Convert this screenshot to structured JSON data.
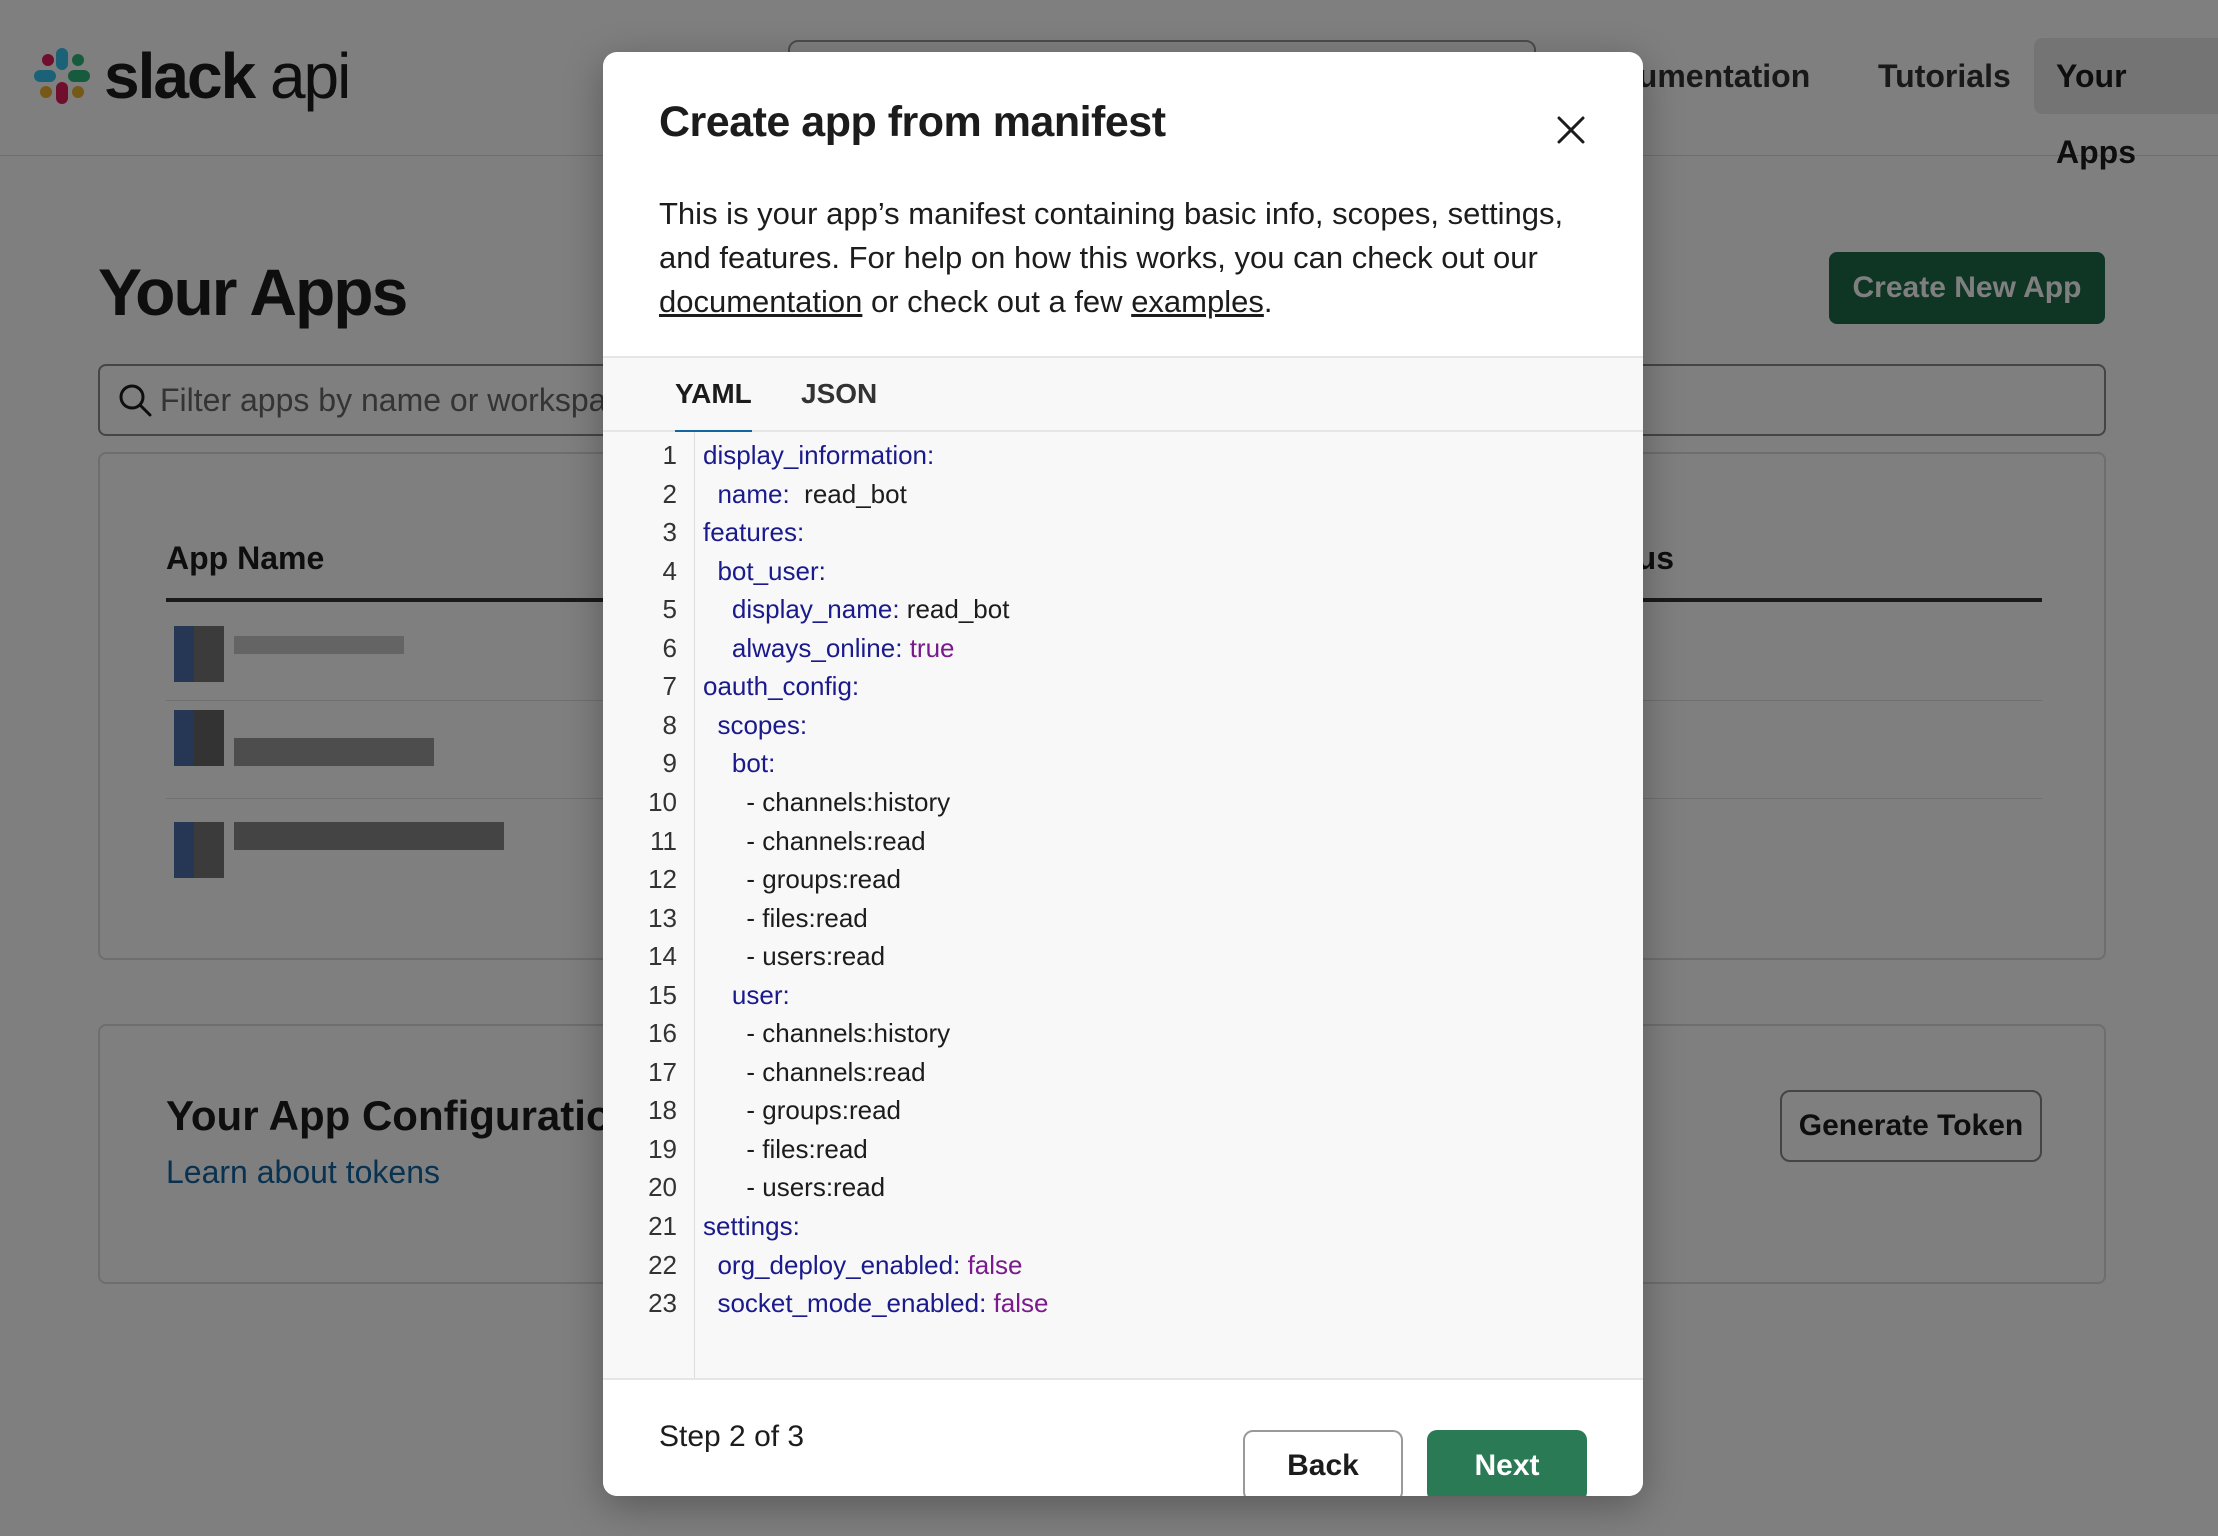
{
  "header": {
    "logo_bold": "slack",
    "logo_light": "api",
    "nav": [
      "cumentation",
      "Tutorials",
      "Your Apps"
    ]
  },
  "main": {
    "title": "Your Apps",
    "create_button": "Create New App",
    "filter_placeholder": "Filter apps by name or workspace",
    "table": {
      "col_name": "App Name",
      "col_status": "tus"
    },
    "token_card": {
      "title": "Your App Configuration T",
      "link": "Learn about tokens",
      "button": "Generate Token"
    }
  },
  "modal": {
    "title": "Create app from manifest",
    "description_prefix": "This is your app’s manifest containing basic info, scopes, settings, and features. For help on how this works, you can check out our ",
    "link_documentation": "documentation",
    "description_middle": " or check out a few ",
    "link_examples": "examples",
    "description_suffix": ".",
    "tabs": [
      "YAML",
      "JSON"
    ],
    "active_tab": "YAML",
    "code_lines": [
      {
        "n": "1",
        "indent": "",
        "key": "display_information",
        "sep": ":",
        "val": "",
        "vtype": "none"
      },
      {
        "n": "2",
        "indent": "  ",
        "key": "name",
        "sep": ":  ",
        "val": "read_bot",
        "vtype": "plain"
      },
      {
        "n": "3",
        "indent": "",
        "key": "features",
        "sep": ":",
        "val": "",
        "vtype": "none"
      },
      {
        "n": "4",
        "indent": "  ",
        "key": "bot_user",
        "sep": ":",
        "val": "",
        "vtype": "none"
      },
      {
        "n": "5",
        "indent": "    ",
        "key": "display_name",
        "sep": ": ",
        "val": "read_bot",
        "vtype": "plain"
      },
      {
        "n": "6",
        "indent": "    ",
        "key": "always_online",
        "sep": ": ",
        "val": "true",
        "vtype": "bool"
      },
      {
        "n": "7",
        "indent": "",
        "key": "oauth_config",
        "sep": ":",
        "val": "",
        "vtype": "none"
      },
      {
        "n": "8",
        "indent": "  ",
        "key": "scopes",
        "sep": ":",
        "val": "",
        "vtype": "none"
      },
      {
        "n": "9",
        "indent": "    ",
        "key": "bot",
        "sep": ":",
        "val": "",
        "vtype": "none"
      },
      {
        "n": "10",
        "indent": "      ",
        "key": "",
        "sep": "- ",
        "val": "channels:history",
        "vtype": "plain"
      },
      {
        "n": "11",
        "indent": "      ",
        "key": "",
        "sep": "- ",
        "val": "channels:read",
        "vtype": "plain"
      },
      {
        "n": "12",
        "indent": "      ",
        "key": "",
        "sep": "- ",
        "val": "groups:read",
        "vtype": "plain"
      },
      {
        "n": "13",
        "indent": "      ",
        "key": "",
        "sep": "- ",
        "val": "files:read",
        "vtype": "plain"
      },
      {
        "n": "14",
        "indent": "      ",
        "key": "",
        "sep": "- ",
        "val": "users:read",
        "vtype": "plain"
      },
      {
        "n": "15",
        "indent": "    ",
        "key": "user",
        "sep": ":",
        "val": "",
        "vtype": "none"
      },
      {
        "n": "16",
        "indent": "      ",
        "key": "",
        "sep": "- ",
        "val": "channels:history",
        "vtype": "plain"
      },
      {
        "n": "17",
        "indent": "      ",
        "key": "",
        "sep": "- ",
        "val": "channels:read",
        "vtype": "plain"
      },
      {
        "n": "18",
        "indent": "      ",
        "key": "",
        "sep": "- ",
        "val": "groups:read",
        "vtype": "plain"
      },
      {
        "n": "19",
        "indent": "      ",
        "key": "",
        "sep": "- ",
        "val": "files:read",
        "vtype": "plain"
      },
      {
        "n": "20",
        "indent": "      ",
        "key": "",
        "sep": "- ",
        "val": "users:read",
        "vtype": "plain"
      },
      {
        "n": "21",
        "indent": "",
        "key": "settings",
        "sep": ":",
        "val": "",
        "vtype": "none"
      },
      {
        "n": "22",
        "indent": "  ",
        "key": "org_deploy_enabled",
        "sep": ": ",
        "val": "false",
        "vtype": "bool"
      },
      {
        "n": "23",
        "indent": "  ",
        "key": "socket_mode_enabled",
        "sep": ": ",
        "val": "false",
        "vtype": "bool"
      }
    ],
    "step": "Step 2 of 3",
    "back_button": "Back",
    "next_button": "Next"
  },
  "colors": {
    "accent_green": "#2b7a56",
    "tab_underline": "#1264a3",
    "yaml_key": "#1a1a8c",
    "yaml_bool": "#7a1a8c",
    "link_blue": "#1264a3"
  }
}
